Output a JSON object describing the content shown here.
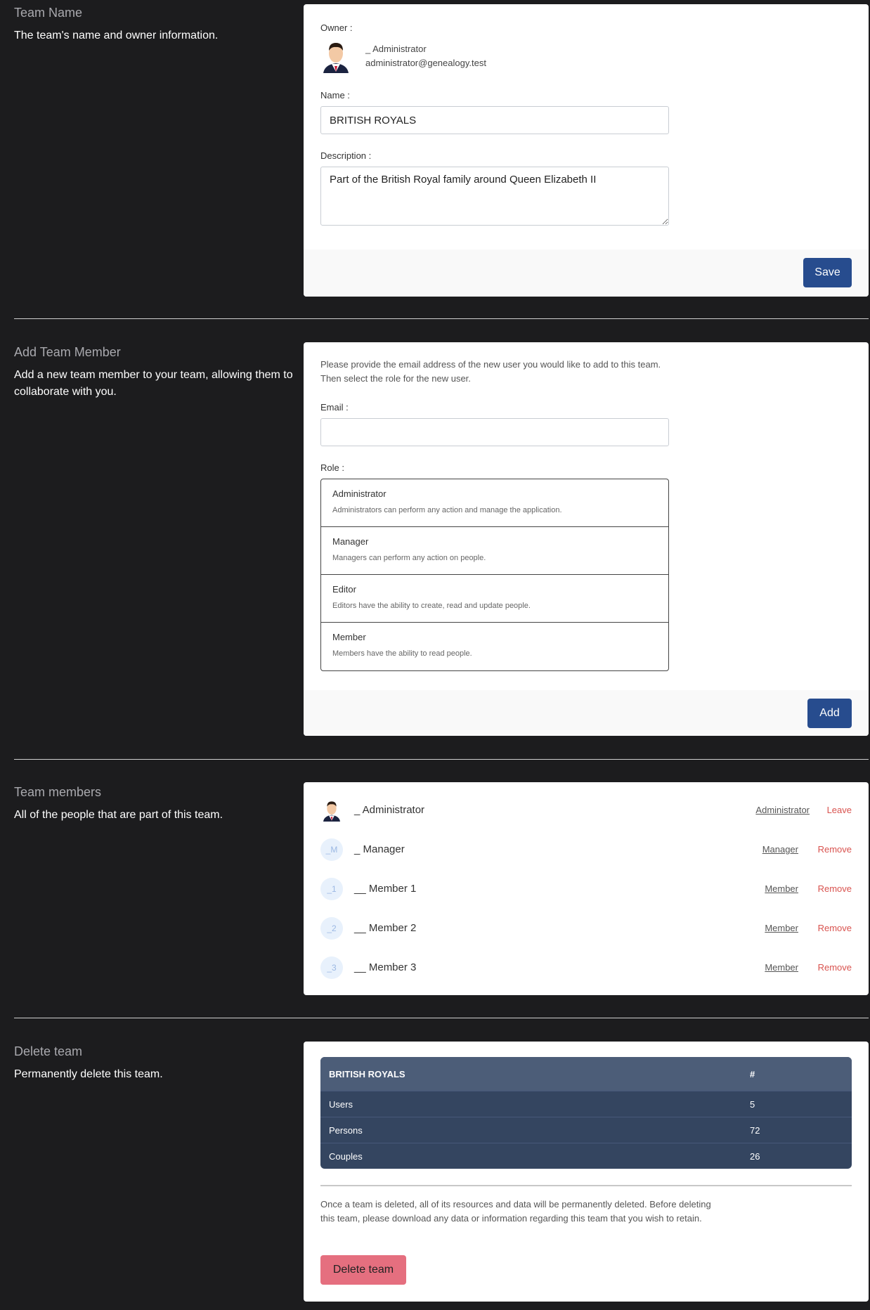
{
  "team_name_section": {
    "title": "Team Name",
    "description": "The team's name and owner information.",
    "owner_label": "Owner :",
    "owner_name": "_ Administrator",
    "owner_email": "administrator@genealogy.test",
    "name_label": "Name :",
    "name_value": "BRITISH ROYALS",
    "description_label": "Description :",
    "description_value": "Part of the British Royal family around Queen Elizabeth II",
    "save_label": "Save"
  },
  "add_member_section": {
    "title": "Add Team Member",
    "description": "Add a new team member to your team, allowing them to collaborate with you.",
    "instructions_line1": "Please provide the email address of the new user you would like to add to this team.",
    "instructions_line2": "Then select the role for the new user.",
    "email_label": "Email :",
    "email_value": "",
    "role_label": "Role :",
    "roles": [
      {
        "name": "Administrator",
        "description": "Administrators can perform any action and manage the application."
      },
      {
        "name": "Manager",
        "description": "Managers can perform any action on people."
      },
      {
        "name": "Editor",
        "description": "Editors have the ability to create, read and update people."
      },
      {
        "name": "Member",
        "description": "Members have the ability to read people."
      }
    ],
    "add_label": "Add"
  },
  "members_section": {
    "title": "Team members",
    "description": "All of the people that are part of this team.",
    "members": [
      {
        "initials": "",
        "name": "_ Administrator",
        "role": "Administrator",
        "action": "Leave"
      },
      {
        "initials": "_M",
        "name": "_ Manager",
        "role": "Manager",
        "action": "Remove"
      },
      {
        "initials": "_1",
        "name": "__ Member 1",
        "role": "Member",
        "action": "Remove"
      },
      {
        "initials": "_2",
        "name": "__ Member 2",
        "role": "Member",
        "action": "Remove"
      },
      {
        "initials": "_3",
        "name": "__ Member 3",
        "role": "Member",
        "action": "Remove"
      }
    ]
  },
  "delete_section": {
    "title": "Delete team",
    "description": "Permanently delete this team.",
    "table_header": "BRITISH ROYALS",
    "table_count_header": "#",
    "rows": [
      {
        "label": "Users",
        "value": "5"
      },
      {
        "label": "Persons",
        "value": "72"
      },
      {
        "label": "Couples",
        "value": "26"
      }
    ],
    "warning": "Once a team is deleted, all of its resources and data will be permanently deleted. Before deleting this team, please download any data or information regarding this team that you wish to retain.",
    "delete_label": "Delete team"
  }
}
